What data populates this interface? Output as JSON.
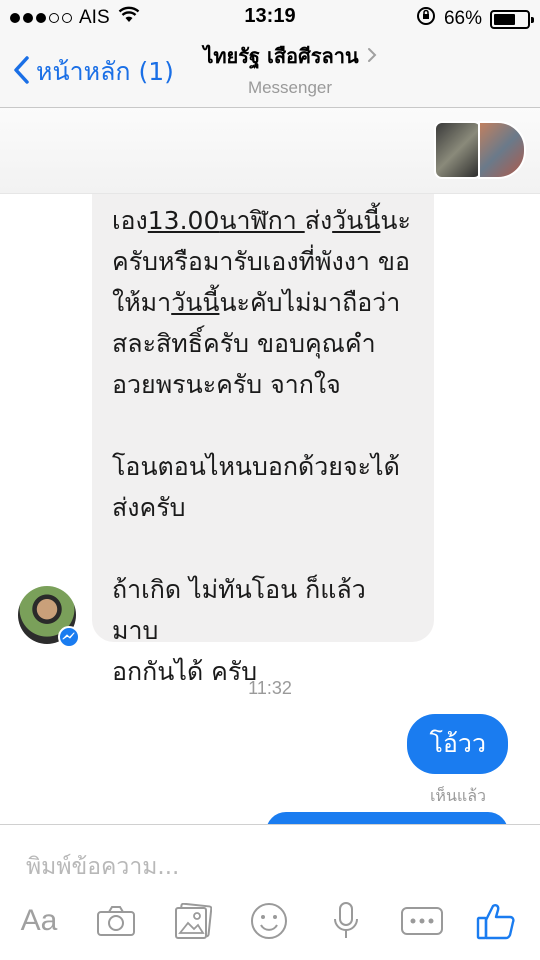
{
  "status_bar": {
    "carrier": "AIS",
    "time": "13:19",
    "battery_percent": "66%",
    "battery_level": 0.66
  },
  "nav": {
    "back_label": "หน้าหลัก (1)",
    "contact_name": "ไทยรัฐ เสือศีรลาน",
    "subtitle": "Messenger"
  },
  "messages": {
    "incoming_parts": {
      "p1a": "เอง",
      "p1b": "13.00",
      "p1c": "นาฬิกา ",
      "p1d": "ส่ง",
      "p1e": "วันนี้",
      "p1f": "นะ\nครับหรือมารับเองที่พังงา ขอ\nให้มา",
      "p1g": "วันนี้",
      "p1h": "นะคับไม่มาถือว่า\nสละสิทธิ์ครับ ขอบคุณคำ\nอวยพรนะครับ จากใจ\n\nโอนตอนไหนบอกด้วยจะได้\nส่งครับ\n\nถ้าเกิด ไม่ทันโอน ก็แล้วมาบ\nอกกันได้ ครับ"
    },
    "timestamp": "11:32",
    "outgoing_text": "โอ้วว",
    "seen_label": "เห็นแล้ว"
  },
  "compose": {
    "placeholder": "พิมพ์ข้อความ...",
    "aa_label": "Aa"
  },
  "icons": [
    "wifi-icon",
    "rotation-lock-icon",
    "battery-icon",
    "back-chevron-icon",
    "chevron-right-icon",
    "camera-icon",
    "photo-icon",
    "emoji-icon",
    "microphone-icon",
    "more-icon",
    "like-icon"
  ],
  "colors": {
    "accent": "#1a7cf0",
    "incoming_bubble": "#f1f0f0",
    "muted_text": "#9a9a9a"
  }
}
